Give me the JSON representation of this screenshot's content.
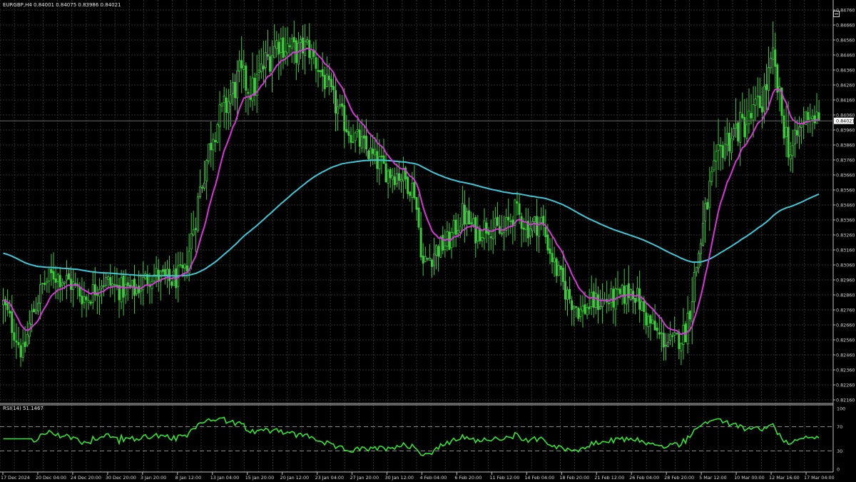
{
  "header": {
    "symbol": "EURGBP,H4",
    "ohlc": "0.84001 0.84075 0.83986 0.84021"
  },
  "rsi_header": "RSI(14) 51.1467",
  "colors": {
    "background": "#000000",
    "grid": "#2f2f2f",
    "candle": "#3ecc3e",
    "fast_ma": "#d936d9",
    "slow_ma": "#3fc8d8",
    "rsi": "#32e632",
    "axis_text": "#d8d8d8",
    "current_price_line": "#6a6a6a"
  },
  "icons": {
    "corner": "chart-shift-icon"
  },
  "chart_data": [
    {
      "type": "candlestick",
      "title": "",
      "symbol": "EURGBP",
      "timeframe": "H4",
      "current_price": "0.84021",
      "ylim": [
        0.8216,
        0.8476
      ],
      "y_ticks": [
        "0.84760",
        "0.84660",
        "0.84560",
        "0.84460",
        "0.84360",
        "0.84260",
        "0.84160",
        "0.84060",
        "0.83960",
        "0.83860",
        "0.83760",
        "0.83660",
        "0.83560",
        "0.83460",
        "0.83360",
        "0.83260",
        "0.83160",
        "0.83060",
        "0.82960",
        "0.82860",
        "0.82760",
        "0.82660",
        "0.82560",
        "0.82460",
        "0.82360",
        "0.82260",
        "0.82160"
      ],
      "x_ticks": [
        "17 Dec 2024",
        "20 Dec 04:00",
        "24 Dec 20:00",
        "30 Dec 20:00",
        "3 Jan 20:00",
        "8 Jan 12:00",
        "13 Jan 04:00",
        "15 Jan 20:00",
        "20 Jan 12:00",
        "23 Jan 04:00",
        "27 Jan 20:00",
        "30 Jan 12:00",
        "4 Feb 04:00",
        "6 Feb 20:00",
        "11 Feb 12:00",
        "14 Feb 04:00",
        "18 Feb 20:00",
        "21 Feb 12:00",
        "26 Feb 04:00",
        "28 Feb 20:00",
        "5 Mar 12:00",
        "10 Mar 00:00",
        "12 Mar 16:00",
        "17 Mar 04:00"
      ],
      "x_end": "17 Mar 2025",
      "price_anchors": [
        [
          0,
          0.828
        ],
        [
          5,
          0.8262
        ],
        [
          9,
          0.8246
        ],
        [
          13,
          0.8272
        ],
        [
          18,
          0.8292
        ],
        [
          23,
          0.83
        ],
        [
          30,
          0.8295
        ],
        [
          38,
          0.8283
        ],
        [
          45,
          0.8296
        ],
        [
          53,
          0.829
        ],
        [
          60,
          0.8289
        ],
        [
          68,
          0.83
        ],
        [
          76,
          0.8295
        ],
        [
          83,
          0.83
        ],
        [
          90,
          0.8356
        ],
        [
          96,
          0.8396
        ],
        [
          102,
          0.8412
        ],
        [
          108,
          0.8432
        ],
        [
          114,
          0.8422
        ],
        [
          120,
          0.8441
        ],
        [
          126,
          0.8456
        ],
        [
          133,
          0.8448
        ],
        [
          139,
          0.8452
        ],
        [
          146,
          0.8432
        ],
        [
          152,
          0.8412
        ],
        [
          158,
          0.8396
        ],
        [
          164,
          0.8386
        ],
        [
          170,
          0.8376
        ],
        [
          176,
          0.8368
        ],
        [
          182,
          0.8366
        ],
        [
          188,
          0.8356
        ],
        [
          192,
          0.8306
        ],
        [
          198,
          0.8316
        ],
        [
          204,
          0.8322
        ],
        [
          210,
          0.834
        ],
        [
          216,
          0.8328
        ],
        [
          222,
          0.8333
        ],
        [
          228,
          0.8326
        ],
        [
          234,
          0.8342
        ],
        [
          240,
          0.8331
        ],
        [
          246,
          0.8335
        ],
        [
          252,
          0.8306
        ],
        [
          258,
          0.8286
        ],
        [
          264,
          0.8275
        ],
        [
          270,
          0.8281
        ],
        [
          276,
          0.8282
        ],
        [
          282,
          0.8284
        ],
        [
          288,
          0.829
        ],
        [
          294,
          0.8271
        ],
        [
          300,
          0.8258
        ],
        [
          306,
          0.8253
        ],
        [
          312,
          0.8262
        ],
        [
          317,
          0.8306
        ],
        [
          323,
          0.8356
        ],
        [
          329,
          0.8386
        ],
        [
          335,
          0.8396
        ],
        [
          341,
          0.8402
        ],
        [
          347,
          0.8416
        ],
        [
          352,
          0.8442
        ],
        [
          356,
          0.8406
        ],
        [
          360,
          0.838
        ],
        [
          364,
          0.8396
        ],
        [
          368,
          0.8408
        ],
        [
          373,
          0.8402
        ]
      ],
      "series": [
        {
          "name": "",
          "kind": "ma",
          "period": 14,
          "color_key": "fast_ma"
        },
        {
          "name": "",
          "kind": "ma",
          "period": 160,
          "color_key": "slow_ma"
        }
      ]
    },
    {
      "type": "line",
      "indicator": "RSI",
      "period": 14,
      "last_value": 51.1467,
      "ylim": [
        0,
        100
      ],
      "y_ticks": [
        "100",
        "70",
        "30",
        "0"
      ],
      "levels": [
        70,
        30
      ]
    }
  ]
}
